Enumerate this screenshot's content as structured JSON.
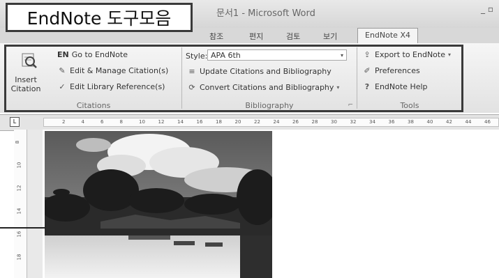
{
  "caption": "EndNote 도구모음",
  "window": {
    "title": "문서1 - Microsoft Word",
    "controls": "_ ▫"
  },
  "tabs": [
    {
      "label": "참조"
    },
    {
      "label": "편지"
    },
    {
      "label": "검토"
    },
    {
      "label": "보기"
    },
    {
      "label": "EndNote X4",
      "active": true
    }
  ],
  "ribbon": {
    "citations": {
      "group_name": "Citations",
      "insert_citation": "Insert Citation",
      "go_to_endnote_prefix": "EN",
      "go_to_endnote": "Go to EndNote",
      "edit_manage": "Edit & Manage Citation(s)",
      "edit_library": "Edit Library Reference(s)"
    },
    "bibliography": {
      "group_name": "Bibliography",
      "style_label": "Style:",
      "style_value": "APA 6th",
      "update": "Update Citations and Bibliography",
      "convert": "Convert Citations and Bibliography"
    },
    "tools": {
      "group_name": "Tools",
      "export": "Export to EndNote",
      "preferences": "Preferences",
      "help": "EndNote Help"
    }
  },
  "ruler": {
    "ticks": [
      "2",
      "4",
      "6",
      "8",
      "10",
      "12",
      "14",
      "16",
      "18",
      "20",
      "22",
      "24",
      "26",
      "28",
      "30",
      "32",
      "34",
      "36",
      "38",
      "40",
      "42",
      "44",
      "46"
    ],
    "vticks": [
      "8",
      "10",
      "12",
      "14",
      "16",
      "18"
    ]
  }
}
